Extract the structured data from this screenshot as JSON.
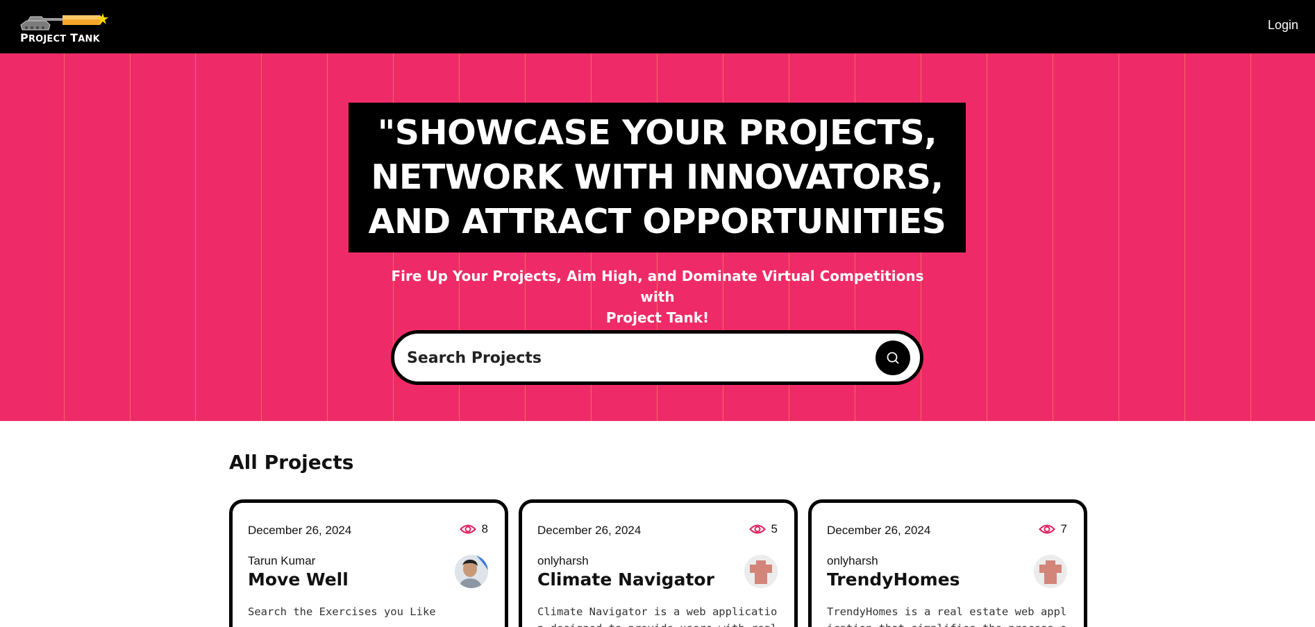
{
  "navbar": {
    "logo_text_big": "P",
    "logo_text_rest": "ROJECT",
    "logo_text_big2": "T",
    "logo_text_rest2": "ANK",
    "login_label": "Login"
  },
  "hero": {
    "headline_line1": "\"SHOWCASE YOUR PROJECTS,",
    "headline_line2": "NETWORK WITH INNOVATORS,",
    "headline_line3": "AND ATTRACT OPPORTUNITIES",
    "subheading_line1": "Fire Up Your Projects, Aim High, and Dominate Virtual Competitions with",
    "subheading_line2": "Project Tank!",
    "search_placeholder": "Search Projects",
    "background_color": "#ee2b68",
    "stripe_color": "#f8725f"
  },
  "projects": {
    "section_title": "All Projects",
    "cards": [
      {
        "date": "December 26, 2024",
        "views": "8",
        "author": "Tarun Kumar",
        "title": "Move Well",
        "description": "Search the Exercises you Like",
        "avatar": "photo-avatar"
      },
      {
        "date": "December 26, 2024",
        "views": "5",
        "author": "onlyharsh",
        "title": "Climate Navigator",
        "description": "Climate Navigator is a web application designed to provide users with real-time weath",
        "avatar": "default-person-avatar"
      },
      {
        "date": "December 26, 2024",
        "views": "7",
        "author": "onlyharsh",
        "title": "TrendyHomes",
        "description": "TrendyHomes is a real estate web application that simplifies the process of finding an",
        "avatar": "default-person-avatar"
      }
    ]
  },
  "colors": {
    "accent": "#ee2b68",
    "eye_icon": "#e11d5c",
    "navbar": "#000000"
  }
}
